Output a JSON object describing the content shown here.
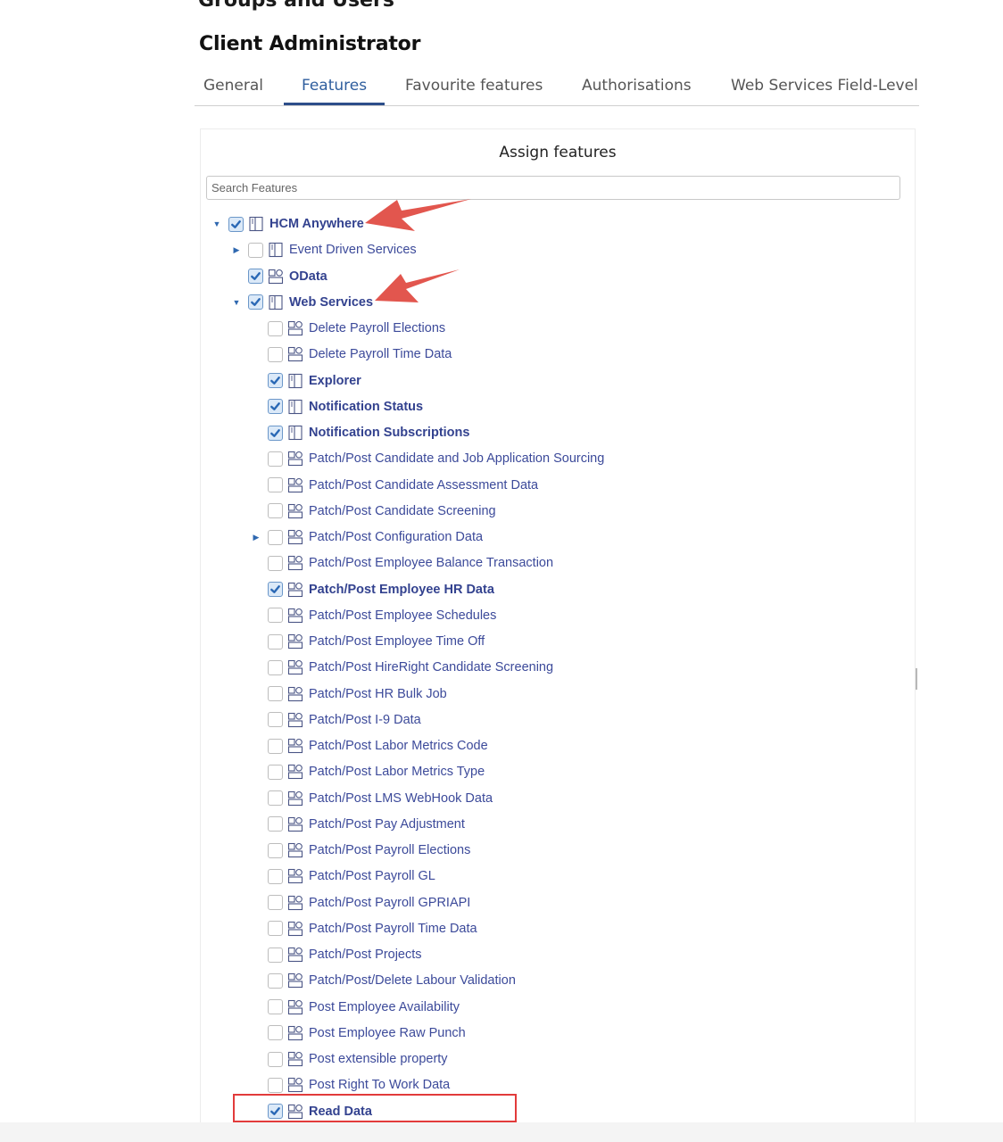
{
  "page": {
    "cut_heading": "Groups and Users",
    "title": "Client Administrator"
  },
  "tabs": [
    {
      "label": "General",
      "active": false
    },
    {
      "label": "Features",
      "active": true
    },
    {
      "label": "Favourite features",
      "active": false
    },
    {
      "label": "Authorisations",
      "active": false
    },
    {
      "label": "Web Services Field-Level",
      "active": false
    }
  ],
  "panel": {
    "title": "Assign features",
    "search_placeholder": "Search Features"
  },
  "colors": {
    "accent": "#2d4e8a",
    "link_text": "#3c4a9a",
    "annotation_red": "#e23b3b"
  },
  "tree": [
    {
      "label": "HCM Anywhere",
      "level": 0,
      "expander": "expanded",
      "checked": true,
      "icon": "folder-icon"
    },
    {
      "label": "Event Driven Services",
      "level": 1,
      "expander": "collapsed",
      "checked": false,
      "icon": "folder-icon"
    },
    {
      "label": "OData",
      "level": 1,
      "expander": "none",
      "checked": true,
      "icon": "feature-icon"
    },
    {
      "label": "Web Services",
      "level": 1,
      "expander": "expanded",
      "checked": true,
      "icon": "folder-icon"
    },
    {
      "label": "Delete Payroll Elections",
      "level": 2,
      "expander": "none",
      "checked": false,
      "icon": "feature-icon"
    },
    {
      "label": "Delete Payroll Time Data",
      "level": 2,
      "expander": "none",
      "checked": false,
      "icon": "feature-icon"
    },
    {
      "label": "Explorer",
      "level": 2,
      "expander": "none",
      "checked": true,
      "icon": "folder-icon"
    },
    {
      "label": "Notification Status",
      "level": 2,
      "expander": "none",
      "checked": true,
      "icon": "folder-icon"
    },
    {
      "label": "Notification Subscriptions",
      "level": 2,
      "expander": "none",
      "checked": true,
      "icon": "folder-icon"
    },
    {
      "label": "Patch/Post Candidate and Job Application Sourcing",
      "level": 2,
      "expander": "none",
      "checked": false,
      "icon": "feature-icon"
    },
    {
      "label": "Patch/Post Candidate Assessment Data",
      "level": 2,
      "expander": "none",
      "checked": false,
      "icon": "feature-icon"
    },
    {
      "label": "Patch/Post Candidate Screening",
      "level": 2,
      "expander": "none",
      "checked": false,
      "icon": "feature-icon"
    },
    {
      "label": "Patch/Post Configuration Data",
      "level": 2,
      "expander": "collapsed",
      "checked": false,
      "icon": "feature-icon"
    },
    {
      "label": "Patch/Post Employee Balance Transaction",
      "level": 2,
      "expander": "none",
      "checked": false,
      "icon": "feature-icon"
    },
    {
      "label": "Patch/Post Employee HR Data",
      "level": 2,
      "expander": "none",
      "checked": true,
      "icon": "feature-icon"
    },
    {
      "label": "Patch/Post Employee Schedules",
      "level": 2,
      "expander": "none",
      "checked": false,
      "icon": "feature-icon"
    },
    {
      "label": "Patch/Post Employee Time Off",
      "level": 2,
      "expander": "none",
      "checked": false,
      "icon": "feature-icon"
    },
    {
      "label": "Patch/Post HireRight Candidate Screening",
      "level": 2,
      "expander": "none",
      "checked": false,
      "icon": "feature-icon"
    },
    {
      "label": "Patch/Post HR Bulk Job",
      "level": 2,
      "expander": "none",
      "checked": false,
      "icon": "feature-icon"
    },
    {
      "label": "Patch/Post I-9 Data",
      "level": 2,
      "expander": "none",
      "checked": false,
      "icon": "feature-icon"
    },
    {
      "label": "Patch/Post Labor Metrics Code",
      "level": 2,
      "expander": "none",
      "checked": false,
      "icon": "feature-icon"
    },
    {
      "label": "Patch/Post Labor Metrics Type",
      "level": 2,
      "expander": "none",
      "checked": false,
      "icon": "feature-icon"
    },
    {
      "label": "Patch/Post LMS WebHook Data",
      "level": 2,
      "expander": "none",
      "checked": false,
      "icon": "feature-icon"
    },
    {
      "label": "Patch/Post Pay Adjustment",
      "level": 2,
      "expander": "none",
      "checked": false,
      "icon": "feature-icon"
    },
    {
      "label": "Patch/Post Payroll Elections",
      "level": 2,
      "expander": "none",
      "checked": false,
      "icon": "feature-icon"
    },
    {
      "label": "Patch/Post Payroll GL",
      "level": 2,
      "expander": "none",
      "checked": false,
      "icon": "feature-icon"
    },
    {
      "label": "Patch/Post Payroll GPRIAPI",
      "level": 2,
      "expander": "none",
      "checked": false,
      "icon": "feature-icon"
    },
    {
      "label": "Patch/Post Payroll Time Data",
      "level": 2,
      "expander": "none",
      "checked": false,
      "icon": "feature-icon"
    },
    {
      "label": "Patch/Post Projects",
      "level": 2,
      "expander": "none",
      "checked": false,
      "icon": "feature-icon"
    },
    {
      "label": "Patch/Post/Delete Labour Validation",
      "level": 2,
      "expander": "none",
      "checked": false,
      "icon": "feature-icon"
    },
    {
      "label": "Post Employee Availability",
      "level": 2,
      "expander": "none",
      "checked": false,
      "icon": "feature-icon"
    },
    {
      "label": "Post Employee Raw Punch",
      "level": 2,
      "expander": "none",
      "checked": false,
      "icon": "feature-icon"
    },
    {
      "label": "Post extensible property",
      "level": 2,
      "expander": "none",
      "checked": false,
      "icon": "feature-icon"
    },
    {
      "label": "Post Right To Work Data",
      "level": 2,
      "expander": "none",
      "checked": false,
      "icon": "feature-icon"
    },
    {
      "label": "Read Data",
      "level": 2,
      "expander": "none",
      "checked": true,
      "icon": "feature-icon",
      "highlighted": true
    }
  ]
}
